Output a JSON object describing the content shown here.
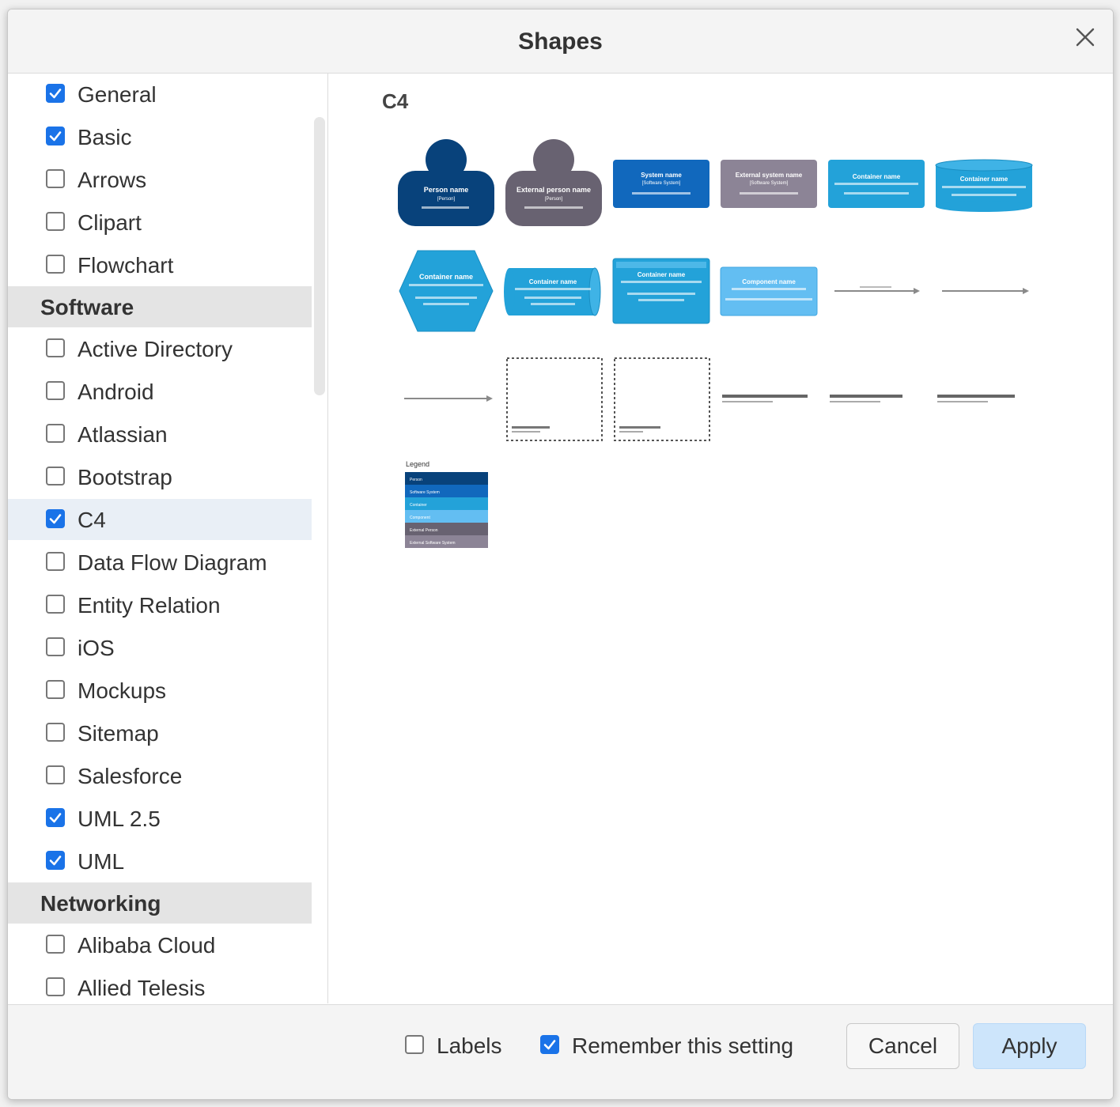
{
  "dialog": {
    "title": "Shapes"
  },
  "sidebar": {
    "items": [
      {
        "type": "item",
        "label": "General",
        "checked": true
      },
      {
        "type": "item",
        "label": "Basic",
        "checked": true
      },
      {
        "type": "item",
        "label": "Arrows",
        "checked": false
      },
      {
        "type": "item",
        "label": "Clipart",
        "checked": false
      },
      {
        "type": "item",
        "label": "Flowchart",
        "checked": false
      },
      {
        "type": "group",
        "label": "Software"
      },
      {
        "type": "item",
        "label": "Active Directory",
        "checked": false
      },
      {
        "type": "item",
        "label": "Android",
        "checked": false
      },
      {
        "type": "item",
        "label": "Atlassian",
        "checked": false
      },
      {
        "type": "item",
        "label": "Bootstrap",
        "checked": false
      },
      {
        "type": "item",
        "label": "C4",
        "checked": true,
        "selected": true
      },
      {
        "type": "item",
        "label": "Data Flow Diagram",
        "checked": false
      },
      {
        "type": "item",
        "label": "Entity Relation",
        "checked": false
      },
      {
        "type": "item",
        "label": "iOS",
        "checked": false
      },
      {
        "type": "item",
        "label": "Mockups",
        "checked": false
      },
      {
        "type": "item",
        "label": "Sitemap",
        "checked": false
      },
      {
        "type": "item",
        "label": "Salesforce",
        "checked": false
      },
      {
        "type": "item",
        "label": "UML 2.5",
        "checked": true
      },
      {
        "type": "item",
        "label": "UML",
        "checked": true
      },
      {
        "type": "group",
        "label": "Networking"
      },
      {
        "type": "item",
        "label": "Alibaba Cloud",
        "checked": false
      },
      {
        "type": "item",
        "label": "Allied Telesis",
        "checked": false
      }
    ]
  },
  "preview": {
    "title": "C4",
    "shapes": {
      "person": "Person name",
      "external_person": "External person name",
      "person_tag": "[Person]",
      "software_system": "System name",
      "software_system_tag": "[Software System]",
      "external_system": "External system name",
      "container": "Container name",
      "container_hex": "Container name",
      "component": "Component name",
      "legend_title": "Legend",
      "legend_items": [
        "Person",
        "Software System",
        "Container",
        "Component",
        "External Person",
        "External Software System"
      ]
    },
    "colors": {
      "person": "#08427b",
      "external": "#686271",
      "system": "#1168bd",
      "container": "#23a2d9",
      "component": "#63bef2"
    }
  },
  "footer": {
    "labels_label": "Labels",
    "labels_checked": false,
    "remember_label": "Remember this setting",
    "remember_checked": true,
    "cancel_label": "Cancel",
    "apply_label": "Apply"
  }
}
